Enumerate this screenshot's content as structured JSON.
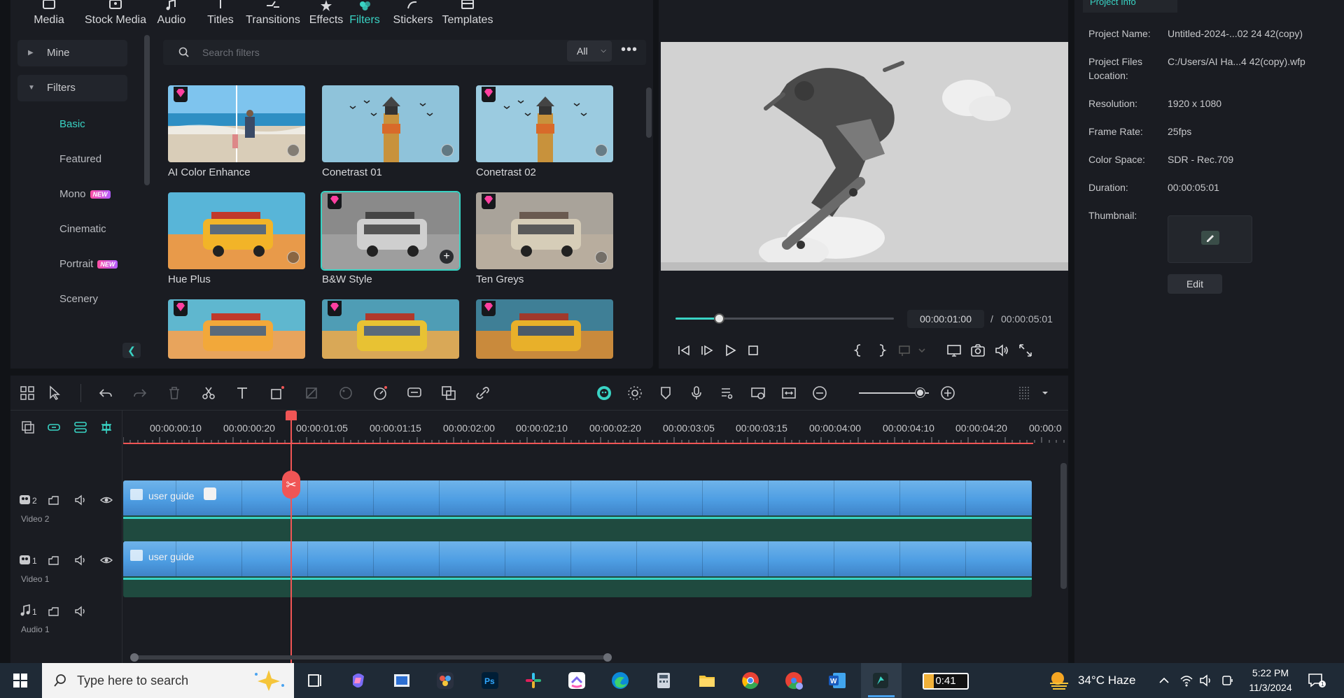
{
  "top_toolbar": {
    "items": [
      {
        "label": "Media",
        "icon": "media-icon"
      },
      {
        "label": "Stock Media",
        "icon": "stock-media-icon"
      },
      {
        "label": "Audio",
        "icon": "audio-icon"
      },
      {
        "label": "Titles",
        "icon": "titles-icon"
      },
      {
        "label": "Transitions",
        "icon": "transitions-icon"
      },
      {
        "label": "Effects",
        "icon": "effects-icon"
      },
      {
        "label": "Filters",
        "icon": "filters-icon",
        "active": true
      },
      {
        "label": "Stickers",
        "icon": "stickers-icon"
      },
      {
        "label": "Templates",
        "icon": "templates-icon"
      }
    ]
  },
  "sidebar": {
    "mine_label": "Mine",
    "filters_label": "Filters",
    "items": [
      {
        "label": "Basic",
        "active": true
      },
      {
        "label": "Featured"
      },
      {
        "label": "Mono",
        "badge": "NEW"
      },
      {
        "label": "Cinematic"
      },
      {
        "label": "Portrait",
        "badge": "NEW"
      },
      {
        "label": "Scenery"
      }
    ]
  },
  "search": {
    "placeholder": "Search filters",
    "filter_value": "All"
  },
  "filters_grid": {
    "cards": [
      {
        "label": "AI Color Enhance",
        "premium": true,
        "selected": false
      },
      {
        "label": "Conetrast 01",
        "premium": false,
        "selected": false
      },
      {
        "label": "Conetrast 02",
        "premium": true,
        "selected": false
      },
      {
        "label": "Hue Plus",
        "premium": false,
        "selected": false
      },
      {
        "label": "B&W Style",
        "premium": true,
        "selected": true
      },
      {
        "label": "Ten Greys",
        "premium": true,
        "selected": false
      }
    ]
  },
  "player": {
    "current_time": "00:00:01:00",
    "separator": "/",
    "total_time": "00:00:05:01",
    "progress": 0.2
  },
  "project_info": {
    "tab_label": "Project Info",
    "rows": [
      {
        "label": "Project Name:",
        "value": "Untitled-2024-...02 24 42(copy)"
      },
      {
        "label": "Project Files Location:",
        "value": "C:/Users/AI Ha...4 42(copy).wfp"
      },
      {
        "label": "Resolution:",
        "value": "1920 x 1080"
      },
      {
        "label": "Frame Rate:",
        "value": "25fps"
      },
      {
        "label": "Color Space:",
        "value": "SDR - Rec.709"
      },
      {
        "label": "Duration:",
        "value": "00:00:05:01"
      },
      {
        "label": "Thumbnail:",
        "value": ""
      }
    ],
    "edit_label": "Edit"
  },
  "timeline": {
    "ruler_ticks": [
      "00:00:00:10",
      "00:00:00:20",
      "00:00:01:05",
      "00:00:01:15",
      "00:00:02:00",
      "00:00:02:10",
      "00:00:02:20",
      "00:00:03:05",
      "00:00:03:15",
      "00:00:04:00",
      "00:00:04:10",
      "00:00:04:20",
      "00:00:0"
    ],
    "tracks": [
      {
        "name": "Video 2",
        "number": "2",
        "clip_label": "user guide"
      },
      {
        "name": "Video 1",
        "number": "1",
        "clip_label": "user guide"
      },
      {
        "name": "Audio 1",
        "number": "1"
      }
    ]
  },
  "taskbar": {
    "search_placeholder": "Type here to search",
    "battery_text": "0:41",
    "weather": "34°C  Haze",
    "time": "5:22 PM",
    "date": "11/3/2024"
  },
  "colors": {
    "accent": "#39d3c4",
    "playhead": "#f05555",
    "panel_bg": "#1a1c22",
    "app_bg": "#111317"
  }
}
